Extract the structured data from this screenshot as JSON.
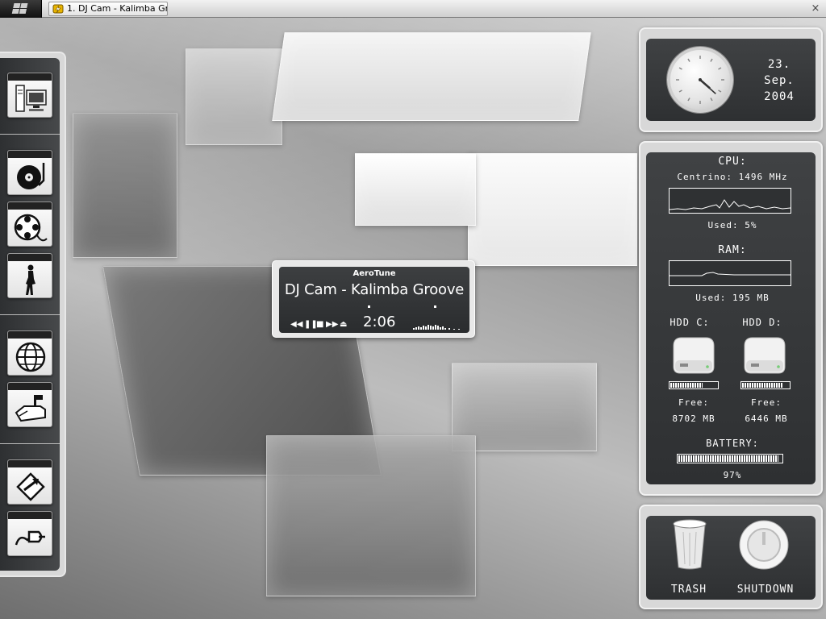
{
  "taskbar": {
    "task_title": "1. DJ Cam - Kalimba Gr...",
    "close_label": "×"
  },
  "dock": {
    "items": [
      {
        "name": "my-computer"
      },
      {
        "name": "music-player"
      },
      {
        "name": "video"
      },
      {
        "name": "pictures"
      },
      {
        "name": "internet"
      },
      {
        "name": "email"
      },
      {
        "name": "network"
      },
      {
        "name": "connect"
      }
    ]
  },
  "player": {
    "app_name": "AeroTune",
    "track": "DJ Cam - Kalimba Groove",
    "time": "2:06",
    "controls": [
      "prev-icon",
      "pause-icon",
      "stop-icon",
      "next-icon",
      "eject-icon"
    ]
  },
  "clock": {
    "day": "23.",
    "month": "Sep.",
    "year": "2004",
    "time_hour": 4,
    "time_minute": 22
  },
  "system": {
    "cpu_title": "CPU:",
    "cpu_model": "Centrino: 1496 MHz",
    "cpu_used": "Used: 5%",
    "ram_title": "RAM:",
    "ram_used": "Used: 195 MB",
    "hdd_c_label": "HDD C:",
    "hdd_d_label": "HDD D:",
    "hdd_c_fill": 0.7,
    "hdd_d_fill": 0.88,
    "free_label": "Free:",
    "hdd_c_free": "8702 MB",
    "hdd_d_free": "6446 MB",
    "battery_title": "BATTERY:",
    "battery_value": "97%",
    "battery_fill": 0.97
  },
  "actions": {
    "trash_label": "TRASH",
    "shutdown_label": "SHUTDOWN"
  }
}
